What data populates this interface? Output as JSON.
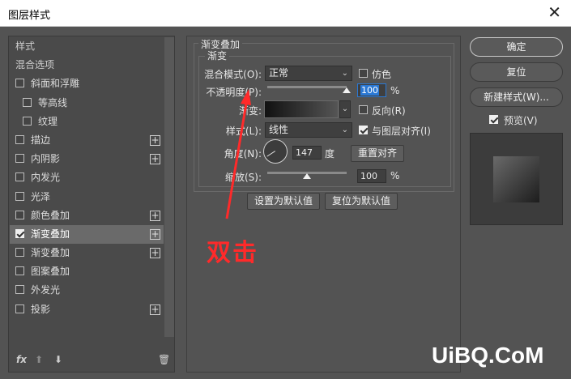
{
  "window": {
    "title": "图层样式",
    "close_icon": "close-icon"
  },
  "left_panel": {
    "items": [
      {
        "label": "样式",
        "kind": "header"
      },
      {
        "label": "混合选项",
        "kind": "header"
      },
      {
        "label": "斜面和浮雕",
        "checked": false,
        "sub": false,
        "plus": false
      },
      {
        "label": "等高线",
        "checked": false,
        "sub": true,
        "plus": false
      },
      {
        "label": "纹理",
        "checked": false,
        "sub": true,
        "plus": false
      },
      {
        "label": "描边",
        "checked": false,
        "sub": false,
        "plus": true
      },
      {
        "label": "内阴影",
        "checked": false,
        "sub": false,
        "plus": true
      },
      {
        "label": "内发光",
        "checked": false,
        "sub": false,
        "plus": false
      },
      {
        "label": "光泽",
        "checked": false,
        "sub": false,
        "plus": false
      },
      {
        "label": "颜色叠加",
        "checked": false,
        "sub": false,
        "plus": true
      },
      {
        "label": "渐变叠加",
        "checked": true,
        "sub": false,
        "plus": true,
        "selected": true
      },
      {
        "label": "渐变叠加",
        "checked": false,
        "sub": false,
        "plus": true
      },
      {
        "label": "图案叠加",
        "checked": false,
        "sub": false,
        "plus": false
      },
      {
        "label": "外发光",
        "checked": false,
        "sub": false,
        "plus": false
      },
      {
        "label": "投影",
        "checked": false,
        "sub": false,
        "plus": true
      }
    ],
    "bottom": {
      "fx": "fx",
      "up_arrow": "⬆",
      "down_arrow": "⬇",
      "trash": "🗑"
    }
  },
  "main": {
    "group_title": "渐变叠加",
    "sub_group_title": "渐变",
    "blend_mode": {
      "label": "混合模式(O):",
      "value": "正常"
    },
    "dither": {
      "label": "仿色",
      "checked": false
    },
    "opacity": {
      "label": "不透明度(P):",
      "value": "100",
      "unit": "%",
      "fraction": 1.0
    },
    "gradient": {
      "label": "渐变:"
    },
    "reverse": {
      "label": "反向(R)",
      "checked": false
    },
    "style": {
      "label": "样式(L):",
      "value": "线性"
    },
    "align_layer": {
      "label": "与图层对齐(I)",
      "checked": true
    },
    "angle": {
      "label": "角度(N):",
      "value": "147",
      "unit": "度",
      "degrees": 147
    },
    "reset_align_button": "重置对齐",
    "scale": {
      "label": "缩放(S):",
      "value": "100",
      "unit": "%",
      "fraction": 0.5
    },
    "make_default_button": "设置为默认值",
    "reset_default_button": "复位为默认值"
  },
  "right": {
    "ok_button": "确定",
    "reset_button": "复位",
    "new_style_button": "新建样式(W)...",
    "preview": {
      "label": "预览(V)",
      "checked": true
    }
  },
  "annotation": {
    "text": "双击",
    "color": "#ff2a2a"
  },
  "watermark": "UiBQ.CoM"
}
